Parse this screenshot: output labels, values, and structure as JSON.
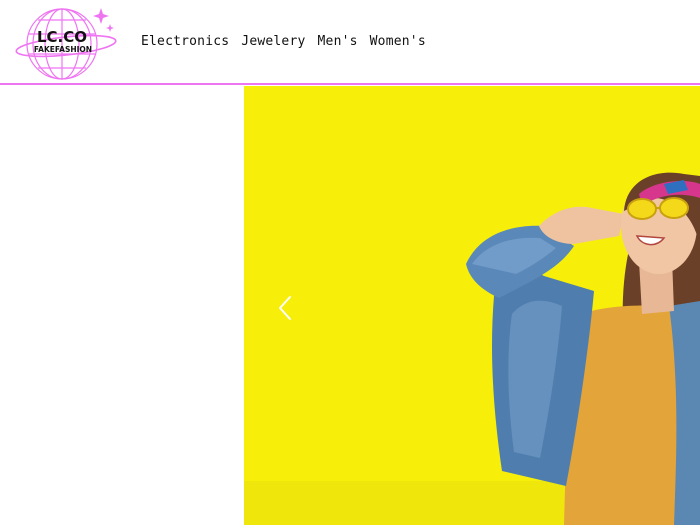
{
  "brand": {
    "logo_line1": "LC.CO",
    "logo_line2": "FAKEFASHION",
    "accent_color": "#ef74f2"
  },
  "nav": {
    "items": [
      {
        "label": "Electronics"
      },
      {
        "label": "Jewelery"
      },
      {
        "label": "Men's"
      },
      {
        "label": "Women's"
      }
    ]
  },
  "hero": {
    "background_color": "#f7ef0a",
    "prev_icon": "chevron-left-icon"
  }
}
